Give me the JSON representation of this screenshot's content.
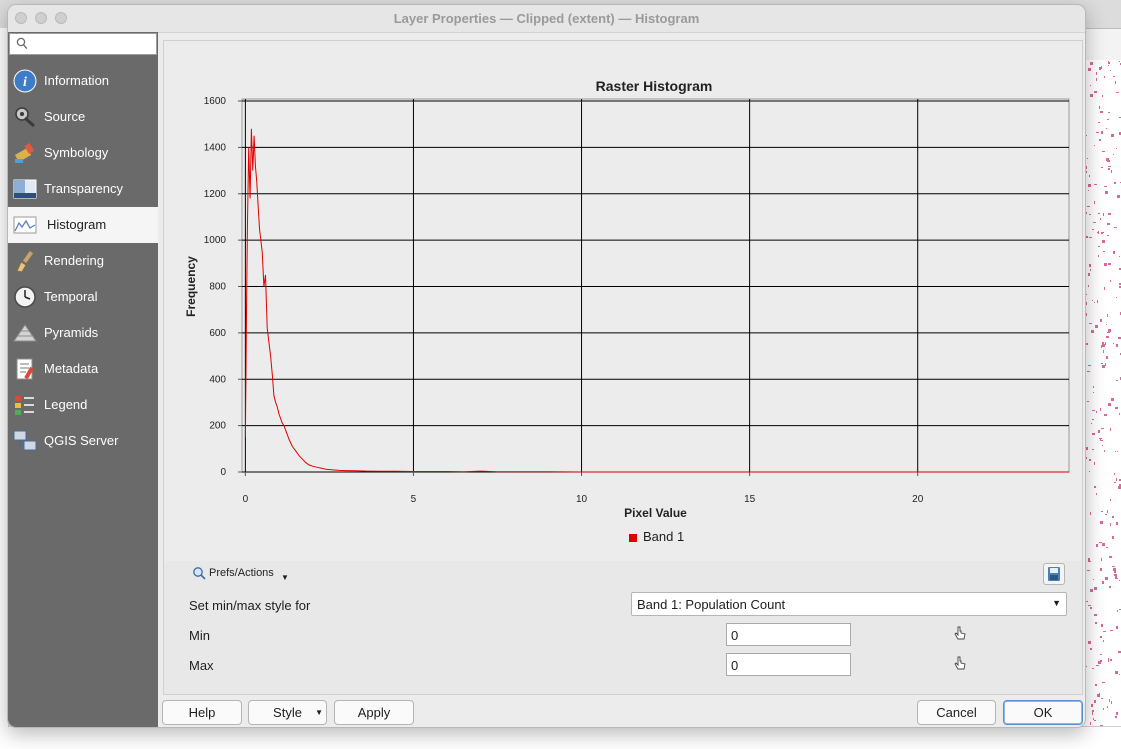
{
  "window": {
    "title": "Layer Properties — Clipped (extent) — Histogram"
  },
  "search": {
    "placeholder": ""
  },
  "sidebar": {
    "items": [
      {
        "label": "Information",
        "icon": "information-icon"
      },
      {
        "label": "Source",
        "icon": "source-icon"
      },
      {
        "label": "Symbology",
        "icon": "symbology-icon"
      },
      {
        "label": "Transparency",
        "icon": "transparency-icon"
      },
      {
        "label": "Histogram",
        "icon": "histogram-icon",
        "active": true
      },
      {
        "label": "Rendering",
        "icon": "rendering-icon"
      },
      {
        "label": "Temporal",
        "icon": "clock-icon"
      },
      {
        "label": "Pyramids",
        "icon": "pyramids-icon"
      },
      {
        "label": "Metadata",
        "icon": "metadata-icon"
      },
      {
        "label": "Legend",
        "icon": "legend-icon"
      },
      {
        "label": "QGIS Server",
        "icon": "server-icon"
      }
    ]
  },
  "chart_data": {
    "type": "line",
    "title": "Raster Histogram",
    "xlabel": "Pixel Value",
    "ylabel": "Frequency",
    "xlim": [
      -0.1,
      24.5
    ],
    "ylim": [
      0,
      1600
    ],
    "xticks": [
      0,
      5,
      10,
      15,
      20
    ],
    "yticks": [
      0,
      200,
      400,
      600,
      800,
      1000,
      1200,
      1400,
      1600
    ],
    "grid": true,
    "legend": "bottom-center",
    "series": [
      {
        "name": "Band 1",
        "color": "#e00000",
        "x": [
          0.0,
          0.03,
          0.06,
          0.1,
          0.14,
          0.18,
          0.22,
          0.26,
          0.3,
          0.34,
          0.38,
          0.42,
          0.46,
          0.5,
          0.55,
          0.6,
          0.65,
          0.7,
          0.75,
          0.8,
          0.85,
          0.9,
          0.95,
          1.0,
          1.05,
          1.1,
          1.15,
          1.2,
          1.3,
          1.4,
          1.5,
          1.6,
          1.7,
          1.8,
          1.9,
          2.0,
          2.2,
          2.4,
          2.6,
          2.8,
          3.0,
          3.3,
          3.6,
          4.0,
          4.5,
          5.0,
          5.5,
          6.0,
          6.5,
          7.0,
          7.5,
          8.0,
          9.0,
          10.0,
          12.0,
          15.0,
          18.0,
          21.0,
          24.5
        ],
        "values": [
          150,
          650,
          1050,
          1400,
          1180,
          1480,
          1300,
          1450,
          1320,
          1250,
          1150,
          1050,
          1000,
          950,
          800,
          850,
          620,
          560,
          500,
          420,
          330,
          300,
          280,
          250,
          230,
          210,
          200,
          180,
          140,
          110,
          90,
          70,
          55,
          40,
          30,
          25,
          18,
          12,
          9,
          7,
          6,
          5,
          4,
          3,
          3,
          2,
          2,
          2,
          1,
          4,
          1,
          1,
          1,
          0,
          0,
          0,
          0,
          0,
          0
        ]
      }
    ]
  },
  "prefs": {
    "label": "Prefs/Actions"
  },
  "form": {
    "minmax_label": "Set min/max style for",
    "minmax_value": "Band 1: Population Count",
    "min_label": "Min",
    "min_value": "0",
    "max_label": "Max",
    "max_value": "0"
  },
  "buttons": {
    "help": "Help",
    "style": "Style",
    "apply": "Apply",
    "cancel": "Cancel",
    "ok": "OK"
  }
}
